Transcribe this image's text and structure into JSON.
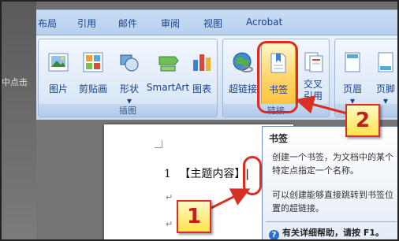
{
  "backdrop": {
    "text": "中点击"
  },
  "tabs": [
    "布局",
    "引用",
    "邮件",
    "审阅",
    "视图",
    "Acrobat"
  ],
  "groups": {
    "illustrations": {
      "caption": "插图",
      "buttons": [
        {
          "label": "图片",
          "icon": "picture-icon"
        },
        {
          "label": "剪贴画",
          "icon": "clipart-icon"
        },
        {
          "label": "形状",
          "icon": "shapes-icon"
        },
        {
          "label": "SmartArt",
          "icon": "smartart-icon"
        },
        {
          "label": "图表",
          "icon": "chart-icon"
        }
      ]
    },
    "links": {
      "caption": "链接",
      "buttons": [
        {
          "label": "超链接",
          "icon": "hyperlink-icon"
        },
        {
          "label": "书签",
          "icon": "bookmark-icon"
        },
        {
          "label": "交叉",
          "label2": "引用",
          "icon": "cross-reference-icon"
        }
      ]
    },
    "header_footer": {
      "caption": "页",
      "buttons": [
        {
          "label": "页眉",
          "icon": "header-icon"
        },
        {
          "label": "页脚",
          "icon": "footer-icon"
        }
      ]
    }
  },
  "document": {
    "line_number": "1",
    "line_text": "【主题内容】",
    "cursor": "|"
  },
  "tooltip": {
    "title": "书签",
    "text1": "创建一个书签，为文档中的某个特定点指定一个名称。",
    "text2": "可以创建能够直接跳转到书签位置的超链接。",
    "help": "有关详细帮助，请按 F1。"
  },
  "callouts": {
    "first": "1",
    "second": "2"
  },
  "colors": {
    "highlight": "#e02a20",
    "callout_fill": "#ffe34d",
    "ribbon_text": "#15428b"
  }
}
